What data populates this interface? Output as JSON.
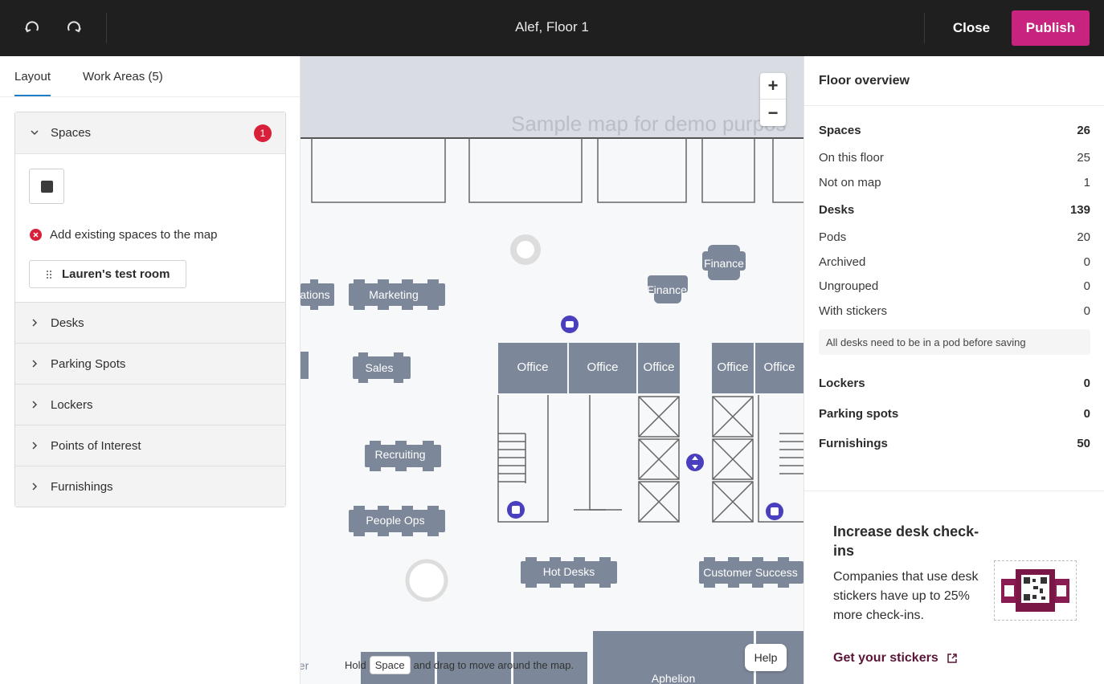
{
  "header": {
    "title": "Alef, Floor 1",
    "close_label": "Close",
    "publish_label": "Publish",
    "undo_icon": "undo-icon",
    "redo_icon": "redo-icon"
  },
  "left_panel": {
    "tabs": [
      {
        "label": "Layout",
        "active": true
      },
      {
        "label": "Work Areas (5)",
        "active": false
      }
    ],
    "spaces": {
      "label": "Spaces",
      "badge": "1",
      "error_text": "Add existing spaces to the map",
      "chip_label": "Lauren's test room"
    },
    "sections": [
      {
        "label": "Desks"
      },
      {
        "label": "Parking Spots"
      },
      {
        "label": "Lockers"
      },
      {
        "label": "Points of Interest"
      },
      {
        "label": "Furnishings"
      }
    ]
  },
  "map": {
    "watermark": "Sample map for demo purpos",
    "zoom_in": "+",
    "zoom_out": "−",
    "hint_before": "Hold",
    "hint_key": "Space",
    "hint_after": "and drag to move around the map.",
    "help_label": "Help",
    "labels": {
      "operations": "ations",
      "marketing": "Marketing",
      "finance1": "Finance",
      "finance2": "Finance",
      "sales": "Sales",
      "office1": "Office",
      "office2": "Office",
      "office3": "Office",
      "office4": "Office",
      "office5": "Office",
      "recruiting": "Recruiting",
      "peopleops": "People Ops",
      "hotdesks": "Hot Desks",
      "customersuccess": "Customer Success",
      "aphelion": "Aphelion",
      "partial": "er"
    },
    "colors": {
      "room": "#7c8799",
      "accent": "#4a3fbf"
    }
  },
  "right_panel": {
    "title": "Floor overview",
    "stats": [
      {
        "label": "Spaces",
        "value": "26",
        "bold": true
      },
      {
        "label": "On this floor",
        "value": "25",
        "bold": false
      },
      {
        "label": "Not on map",
        "value": "1",
        "bold": false
      },
      {
        "label": "Desks",
        "value": "139",
        "bold": true
      },
      {
        "label": "Pods",
        "value": "20",
        "bold": false
      },
      {
        "label": "Archived",
        "value": "0",
        "bold": false
      },
      {
        "label": "Ungrouped",
        "value": "0",
        "bold": false
      },
      {
        "label": "With stickers",
        "value": "0",
        "bold": false
      }
    ],
    "note": "All desks need to be in a pod before saving",
    "stats2": [
      {
        "label": "Lockers",
        "value": "0",
        "bold": true
      },
      {
        "label": "Parking spots",
        "value": "0",
        "bold": true
      },
      {
        "label": "Furnishings",
        "value": "50",
        "bold": true
      }
    ],
    "promo": {
      "title": "Increase desk check-ins",
      "text": "Companies that use desk stickers have up to 25% more check-ins.",
      "link": "Get your stickers"
    }
  },
  "colors": {
    "brand": "#c8237f",
    "tab_underline": "#1f7ec4",
    "error": "#d8203a",
    "link": "#5a1638"
  }
}
